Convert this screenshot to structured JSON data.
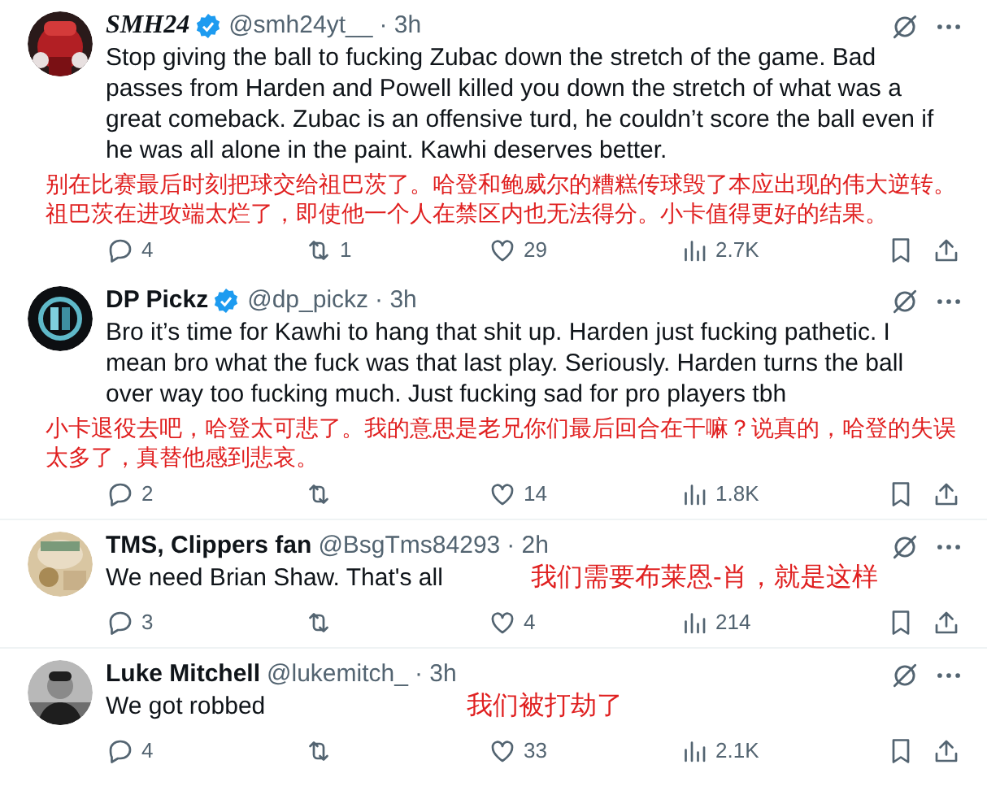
{
  "replies": [
    {
      "name": "SMH24",
      "kind": "fancy",
      "verified": true,
      "handle": "@smh24yt__",
      "time": "· 3h",
      "text": "Stop giving the ball to fucking Zubac down the stretch of the game. Bad passes from Harden and Powell killed you down the stretch of what was a great comeback. Zubac is an offensive turd, he couldn’t score the ball even if he was all alone in the paint. Kawhi deserves better.",
      "translation": {
        "kind": "below",
        "text": "别在比赛最后时刻把球交给祖巴茨了。哈登和鲍威尔的糟糕传球毁了本应出现的伟大逆转。祖巴茨在进攻端太烂了，即使他一个人在禁区内也无法得分。小卡值得更好的结果。"
      },
      "stats": {
        "replies": "4",
        "reposts": "1",
        "likes": "29",
        "views": "2.7K"
      }
    },
    {
      "name": "DP Pickz",
      "kind": "plain",
      "verified": true,
      "handle": "@dp_pickz",
      "time": "· 3h",
      "text": "Bro it’s time for Kawhi to hang that shit up. Harden just fucking pathetic. I mean bro what the fuck was that last play. Seriously. Harden turns the ball over way too fucking much. Just fucking sad for pro players tbh",
      "translation": {
        "kind": "below",
        "text": "小卡退役去吧，哈登太可悲了。我的意思是老兄你们最后回合在干嘛？说真的，哈登的失误太多了，真替他感到悲哀。"
      },
      "stats": {
        "replies": "2",
        "likes": "14",
        "views": "1.8K"
      }
    },
    {
      "name": "TMS, Clippers fan",
      "kind": "plain",
      "verified": false,
      "handle": "@BsgTms84293",
      "time": "· 2h",
      "text": "We need Brian Shaw. That's all",
      "translation": {
        "kind": "inline",
        "text": "我们需要布莱恩-肖，就是这样"
      },
      "stats": {
        "replies": "3",
        "likes": "4",
        "views": "214"
      }
    },
    {
      "name": "Luke Mitchell",
      "kind": "plain",
      "verified": false,
      "handle": "@lukemitch_",
      "time": "· 3h",
      "text": "We got robbed",
      "translation": {
        "kind": "inline",
        "text": "我们被打劫了"
      },
      "stats": {
        "replies": "4",
        "likes": "33",
        "views": "2.1K"
      }
    }
  ]
}
